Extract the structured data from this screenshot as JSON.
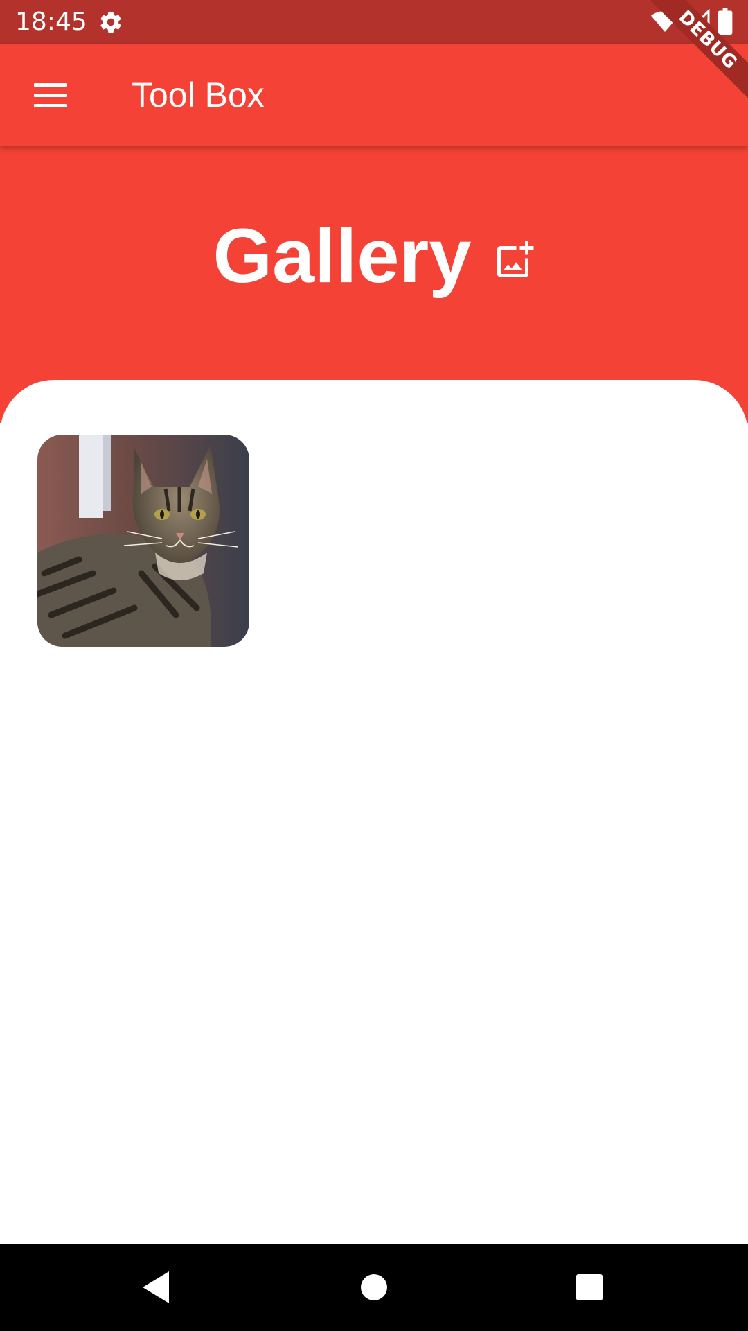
{
  "status_bar": {
    "time": "18:45",
    "background": "#b3322b",
    "icons": [
      "settings-gear-icon",
      "wifi-icon",
      "signal-icon",
      "battery-icon"
    ]
  },
  "debug_banner": {
    "label": "DEBUG"
  },
  "app_bar": {
    "title": "Tool Box",
    "menu_icon": "hamburger-menu-icon",
    "background": "#f44336"
  },
  "header": {
    "title": "Gallery",
    "action_icon": "add-photo-icon"
  },
  "gallery": {
    "images": [
      {
        "subject": "tabby cat",
        "icon": "photo-thumbnail"
      }
    ]
  },
  "nav_bar": {
    "buttons": [
      "back-icon",
      "home-icon",
      "recents-icon"
    ]
  },
  "colors": {
    "primary": "#f44336",
    "status": "#b3322b",
    "surface": "#ffffff",
    "nav": "#000000"
  }
}
